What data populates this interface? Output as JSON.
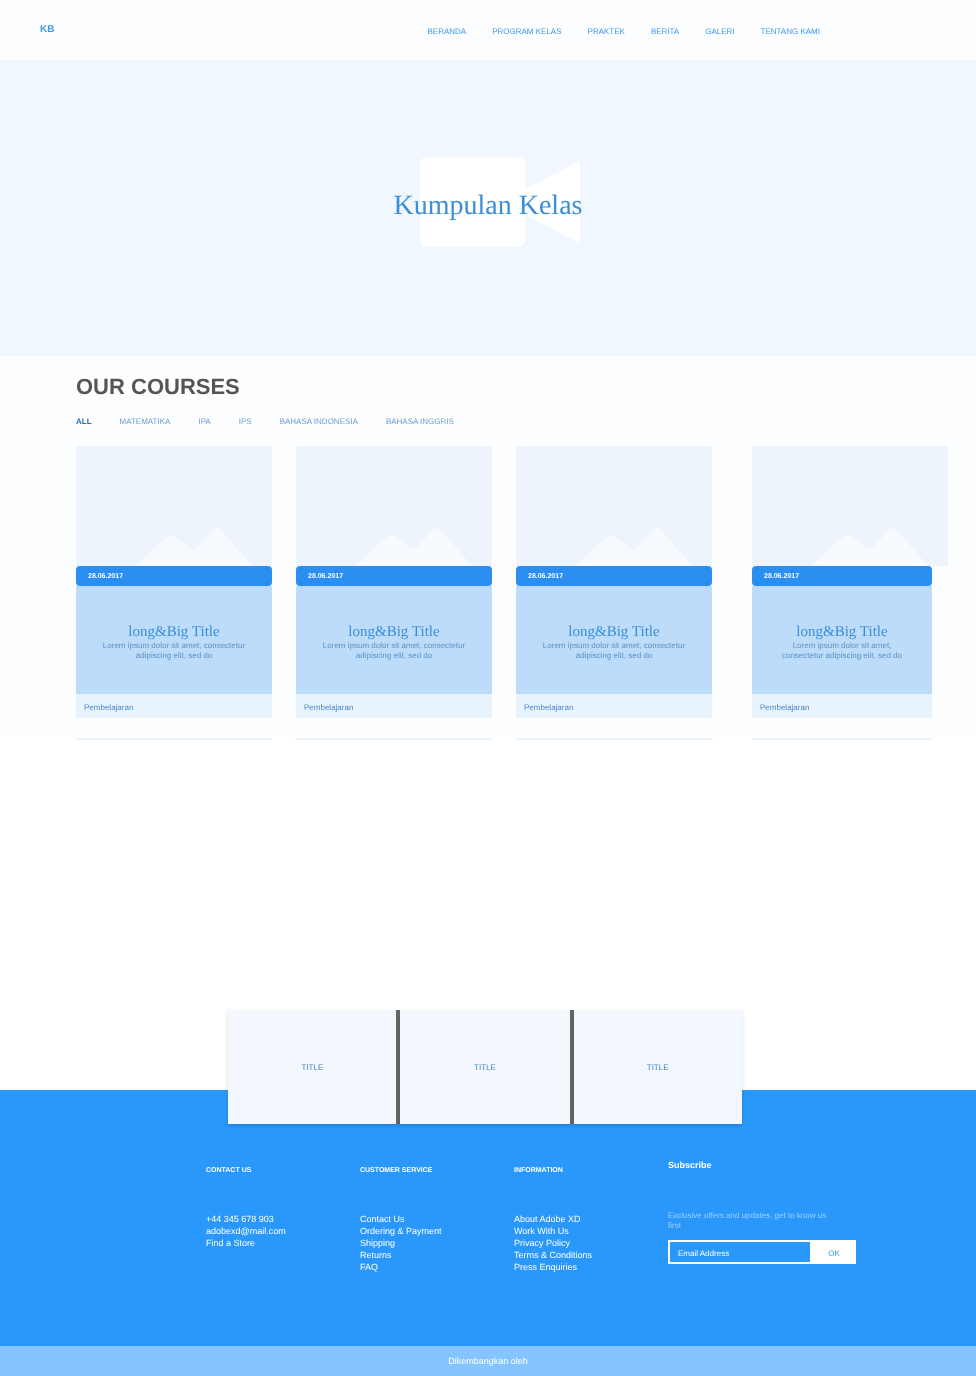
{
  "header": {
    "logo": "KB",
    "nav": [
      {
        "label": "BERANDA",
        "selected": false
      },
      {
        "label": "PROGRAM KELAS",
        "selected": false
      },
      {
        "label": "PRAKTEK",
        "selected": false
      },
      {
        "label": "BERITA",
        "selected": false
      },
      {
        "label": "GALERI",
        "selected": false
      },
      {
        "label": "TENTANG KAMI",
        "selected": false
      }
    ]
  },
  "hero": {
    "title": "Kumpulan Kelas"
  },
  "courses": {
    "heading": "OUR COURSES",
    "filters": [
      {
        "label": "ALL",
        "selected": true
      },
      {
        "label": "MATEMATIKA",
        "selected": false
      },
      {
        "label": "IPA",
        "selected": false
      },
      {
        "label": "IPS",
        "selected": false
      },
      {
        "label": "BAHASA INDONESIA",
        "selected": false
      },
      {
        "label": "BAHASA INGGRIS",
        "selected": false
      }
    ],
    "cards": [
      {
        "date": "28.06.2017",
        "title": "long&Big Title",
        "text": "Lorem ipsum dolor sit amet, consectetur adipiscing elit, sed do",
        "footer": "Pembelajaran"
      },
      {
        "date": "28.06.2017",
        "title": "long&Big Title",
        "text": "Lorem ipsum dolor sit amet, consectetur adipiscing elit, sed do",
        "footer": "Pembelajaran"
      },
      {
        "date": "28.06.2017",
        "title": "long&Big Title",
        "text": "Lorem ipsum dolor sit amet, consectetur adipiscing elit, sed do",
        "footer": "Pembelajaran"
      },
      {
        "date": "28.06.2017",
        "title": "long&Big Title",
        "text": "Lorem ipsum dolor sit amet, consectetur adipiscing elit, sed do",
        "footer": "Pembelajaran"
      }
    ]
  },
  "tiles": [
    "TITLE",
    "TITLE",
    "TITLE"
  ],
  "footer": {
    "columns": [
      {
        "heading": "CONTACT US",
        "links": [
          "+44 345 678 903",
          "adobexd@mail.com",
          "Find a Store"
        ]
      },
      {
        "heading": "CUSTOMER SERVICE",
        "links": [
          "Contact Us",
          "Ordering & Payment",
          "Shipping",
          "Returns",
          "FAQ"
        ]
      },
      {
        "heading": "INFORMATION",
        "links": [
          "About Adobe XD",
          "Work With Us",
          "Privacy Policy",
          "Terms & Conditions",
          "Press Enquiries"
        ]
      }
    ],
    "subscribe": {
      "heading": "Subscribe",
      "text": "Exclusive offers and updates, get to know us first",
      "placeholder": "Email Address",
      "button": "OK"
    },
    "copyright": "Dikembangkan oleh"
  }
}
